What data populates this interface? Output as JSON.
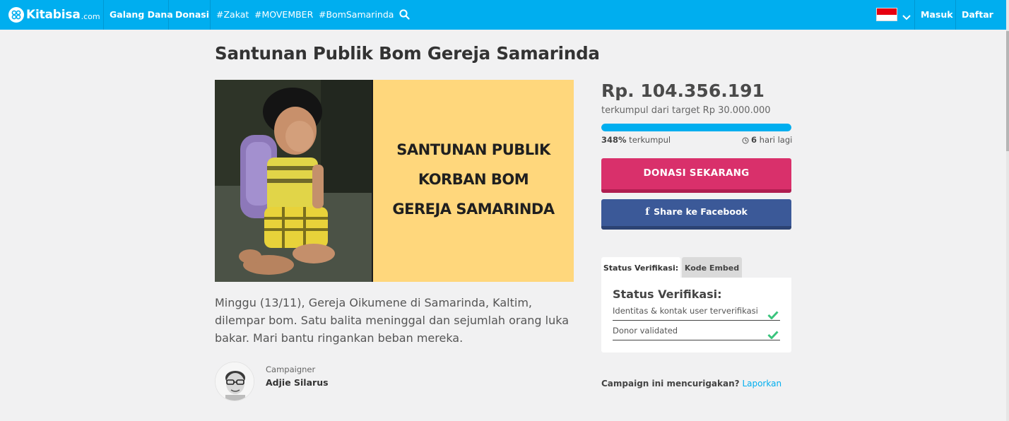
{
  "nav": {
    "logo_text": "Kitabisa",
    "logo_domain": ".com",
    "items": [
      {
        "label": "Galang Dana"
      },
      {
        "label": "Donasi"
      },
      {
        "label": "#Zakat"
      },
      {
        "label": "#MOVEMBER"
      },
      {
        "label": "#BomSamarinda"
      }
    ],
    "search_icon": "search-icon",
    "language_flag": "indonesia-flag",
    "login_label": "Masuk",
    "register_label": "Daftar",
    "brand_color": "#00aeef"
  },
  "campaign": {
    "title": "Santunan Publik Bom Gereja Samarinda",
    "image_text": [
      "SANTUNAN PUBLIK",
      "KORBAN BOM",
      "GEREJA SAMARINDA"
    ],
    "description": "Minggu (13/11), Gereja Oikumene di Samarinda, Kaltim, dilempar bom. Satu balita meninggal dan sejumlah orang luka bakar. Mari bantu ringankan beban mereka.",
    "campaigner_label": "Campaigner",
    "campaigner_name": "Adjie Silarus"
  },
  "funding": {
    "amount": "Rp. 104.356.191",
    "target_text": "terkumpul dari target Rp 30.000.000",
    "progress_fraction": 1.0,
    "percent": "348%",
    "percent_suffix": " terkumpul",
    "days": "6",
    "days_suffix": " hari lagi",
    "progress_color": "#00aeef"
  },
  "actions": {
    "donate_label": "DONASI SEKARANG",
    "donate_color": "#d9306b",
    "share_label": "Share ke Facebook",
    "share_icon": "facebook-icon",
    "share_color": "#3b5998"
  },
  "verification": {
    "tabs": [
      "Status Verifikasi:",
      "Kode Embed"
    ],
    "heading": "Status Verifikasi:",
    "rows": [
      {
        "label": "Identitas & kontak user terverifikasi",
        "icon": "check-icon"
      },
      {
        "label": "Donor validated",
        "icon": "check-icon"
      }
    ],
    "check_color": "#3ac47d"
  },
  "report": {
    "question": "Campaign ini mencurigakan?",
    "link_label": "Laporkan"
  }
}
